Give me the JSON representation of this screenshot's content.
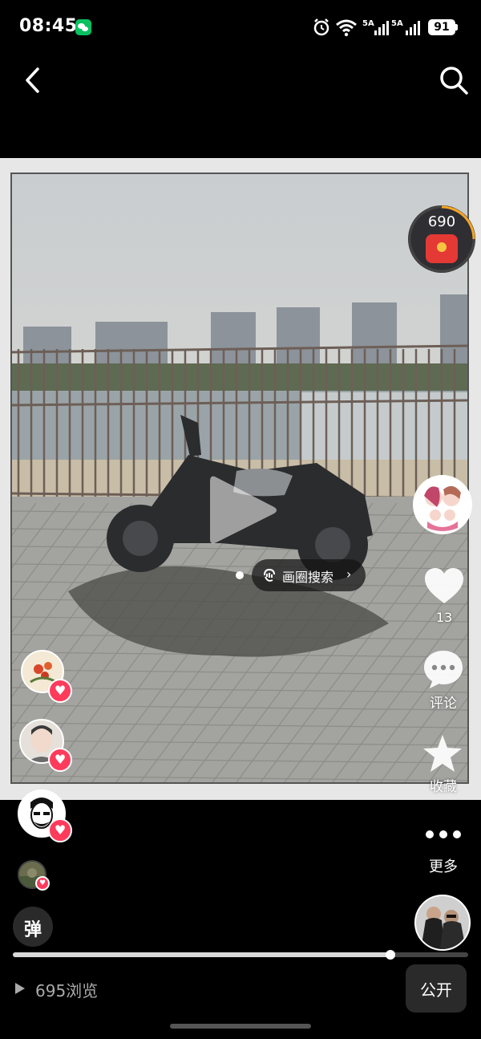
{
  "status_bar": {
    "time": "08:45",
    "battery": "91",
    "icons": [
      "wechat-icon",
      "alarm-icon",
      "wifi-icon",
      "signal-5a-icon",
      "signal-5a-icon"
    ],
    "network_label_1": "5A",
    "network_label_2": "5A"
  },
  "nav": {
    "back_icon": "chevron-left-icon",
    "search_icon": "search-icon"
  },
  "media": {
    "red_packet_count": "690",
    "image_search_label": "画圈搜索",
    "image_search_chevron": "›"
  },
  "actions": {
    "like_count": "13",
    "comment_label": "评论",
    "favorite_label": "收藏",
    "more_label": "更多"
  },
  "danmaku_label": "弹",
  "progress": {
    "fraction": 0.83
  },
  "views_label": "695浏览",
  "public_label": "公开",
  "colors": {
    "accent_red": "#ff3b5c",
    "background": "#000000"
  }
}
